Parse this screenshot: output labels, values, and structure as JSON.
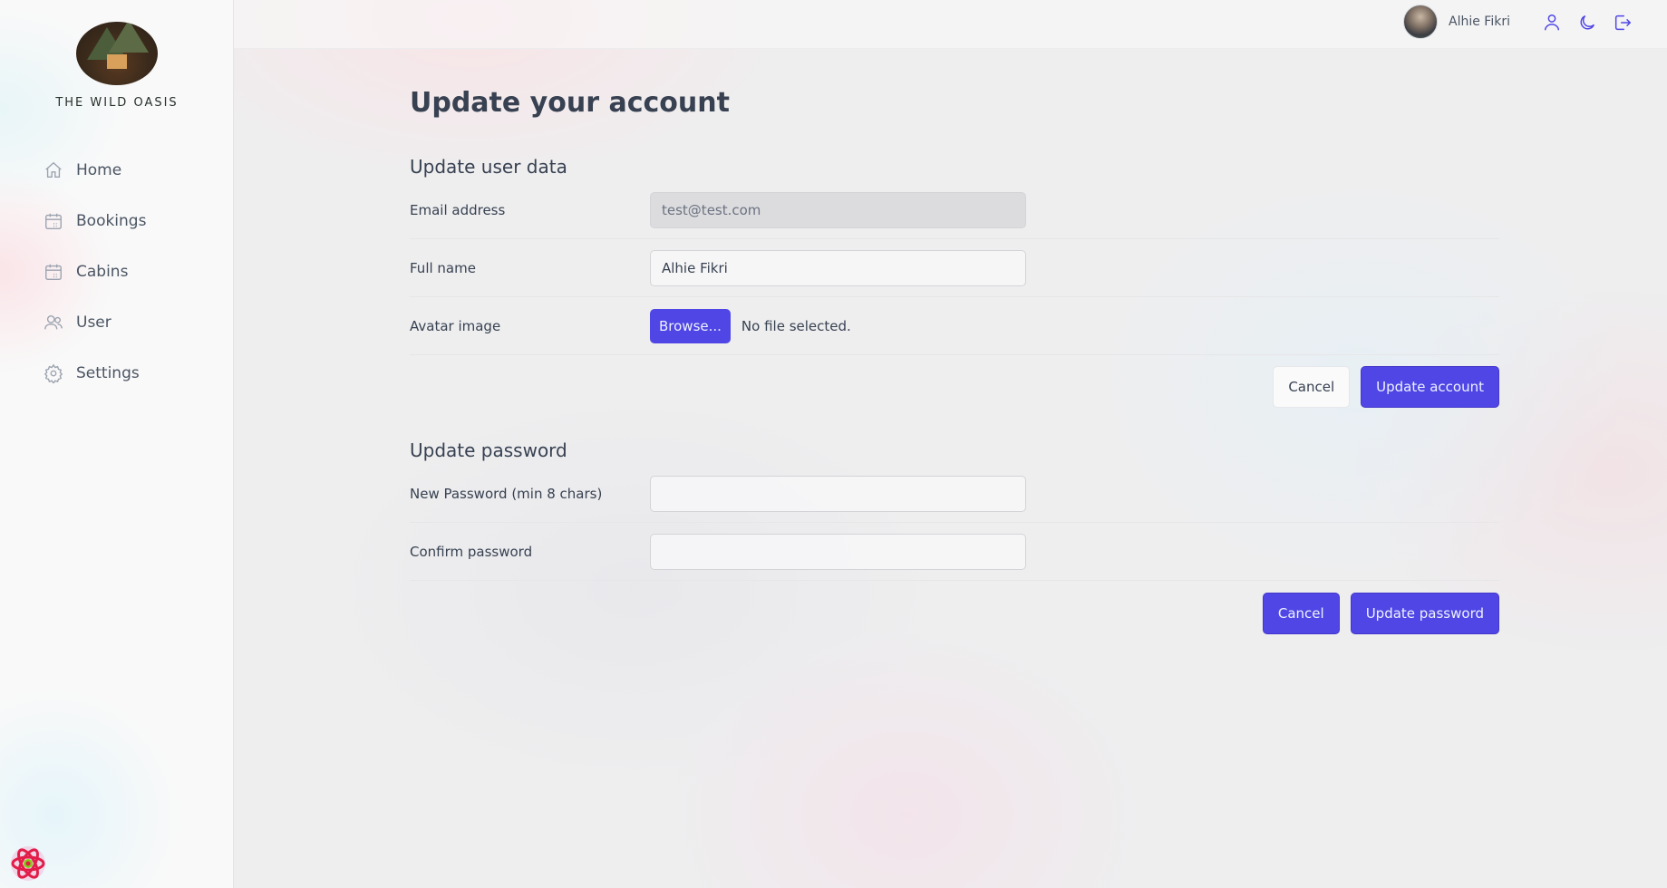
{
  "sidebar": {
    "brand": "THE WILD OASIS",
    "items": [
      {
        "label": "Home",
        "icon": "home-icon"
      },
      {
        "label": "Bookings",
        "icon": "calendar-icon"
      },
      {
        "label": "Cabins",
        "icon": "calendar-icon"
      },
      {
        "label": "User",
        "icon": "users-icon"
      },
      {
        "label": "Settings",
        "icon": "gear-icon"
      }
    ]
  },
  "header": {
    "user_name": "Alhie Fikri",
    "icons": [
      "user-icon",
      "moon-icon",
      "logout-icon"
    ]
  },
  "page": {
    "title": "Update your account"
  },
  "user_data_form": {
    "title": "Update user data",
    "email_label": "Email address",
    "email_value": "test@test.com",
    "fullname_label": "Full name",
    "fullname_value": "Alhie Fikri",
    "avatar_label": "Avatar image",
    "browse_label": "Browse...",
    "file_status": "No file selected.",
    "cancel_label": "Cancel",
    "submit_label": "Update account"
  },
  "password_form": {
    "title": "Update password",
    "new_password_label": "New Password (min 8 chars)",
    "new_password_value": "",
    "confirm_label": "Confirm password",
    "confirm_value": "",
    "cancel_label": "Cancel",
    "submit_label": "Update password"
  },
  "colors": {
    "accent": "#4f46e5",
    "text": "#374151"
  }
}
